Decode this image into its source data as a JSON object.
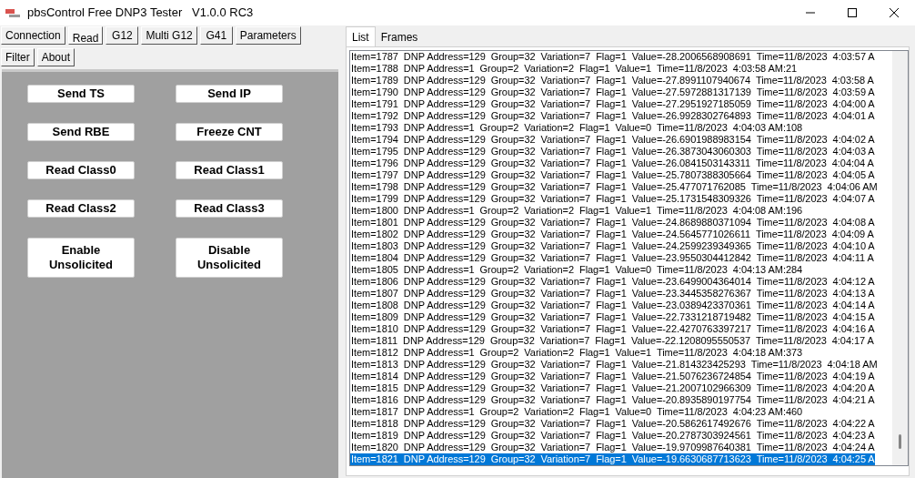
{
  "window": {
    "title": "pbsControl Free DNP3 Tester   V1.0.0 RC3"
  },
  "tab_rows": [
    [
      {
        "label": "Connection",
        "selected": false
      },
      {
        "label": "Read",
        "selected": true
      },
      {
        "label": "G12",
        "selected": false
      },
      {
        "label": "Multi G12",
        "selected": false
      },
      {
        "label": "G41",
        "selected": false
      },
      {
        "label": "Parameters",
        "selected": false
      }
    ],
    [
      {
        "label": "Filter",
        "selected": false
      },
      {
        "label": "About",
        "selected": false
      }
    ]
  ],
  "buttons": [
    {
      "label": "Send TS"
    },
    {
      "label": "Send IP"
    },
    {
      "label": "Send RBE"
    },
    {
      "label": "Freeze CNT"
    },
    {
      "label": "Read Class0"
    },
    {
      "label": "Read  Class1"
    },
    {
      "label": "Read  Class2"
    },
    {
      "label": "Read  Class3"
    },
    {
      "label": "Enable Unsolicited"
    },
    {
      "label": "Disable Unsolicited"
    }
  ],
  "list_tabs": [
    {
      "label": "List",
      "selected": true
    },
    {
      "label": "Frames",
      "selected": false
    }
  ],
  "list": {
    "rows": [
      {
        "text": "Item=1787  DNP Address=129  Group=32  Variation=7  Flag=1  Value=-28.2006568908691  Time=11/8/2023  4:03:57 A",
        "selected": false
      },
      {
        "text": "Item=1788  DNP Address=1  Group=2  Variation=2  Flag=1  Value=1  Time=11/8/2023  4:03:58 AM:21",
        "selected": false
      },
      {
        "text": "Item=1789  DNP Address=129  Group=32  Variation=7  Flag=1  Value=-27.8991107940674  Time=11/8/2023  4:03:58 A",
        "selected": false
      },
      {
        "text": "Item=1790  DNP Address=129  Group=32  Variation=7  Flag=1  Value=-27.5972881317139  Time=11/8/2023  4:03:59 A",
        "selected": false
      },
      {
        "text": "Item=1791  DNP Address=129  Group=32  Variation=7  Flag=1  Value=-27.2951927185059  Time=11/8/2023  4:04:00 A",
        "selected": false
      },
      {
        "text": "Item=1792  DNP Address=129  Group=32  Variation=7  Flag=1  Value=-26.9928302764893  Time=11/8/2023  4:04:01 A",
        "selected": false
      },
      {
        "text": "Item=1793  DNP Address=1  Group=2  Variation=2  Flag=1  Value=0  Time=11/8/2023  4:04:03 AM:108",
        "selected": false
      },
      {
        "text": "Item=1794  DNP Address=129  Group=32  Variation=7  Flag=1  Value=-26.6901988983154  Time=11/8/2023  4:04:02 A",
        "selected": false
      },
      {
        "text": "Item=1795  DNP Address=129  Group=32  Variation=7  Flag=1  Value=-26.3873043060303  Time=11/8/2023  4:04:03 A",
        "selected": false
      },
      {
        "text": "Item=1796  DNP Address=129  Group=32  Variation=7  Flag=1  Value=-26.0841503143311  Time=11/8/2023  4:04:04 A",
        "selected": false
      },
      {
        "text": "Item=1797  DNP Address=129  Group=32  Variation=7  Flag=1  Value=-25.7807388305664  Time=11/8/2023  4:04:05 A",
        "selected": false
      },
      {
        "text": "Item=1798  DNP Address=129  Group=32  Variation=7  Flag=1  Value=-25.477071762085  Time=11/8/2023  4:04:06 AM",
        "selected": false
      },
      {
        "text": "Item=1799  DNP Address=129  Group=32  Variation=7  Flag=1  Value=-25.1731548309326  Time=11/8/2023  4:04:07 A",
        "selected": false
      },
      {
        "text": "Item=1800  DNP Address=1  Group=2  Variation=2  Flag=1  Value=1  Time=11/8/2023  4:04:08 AM:196",
        "selected": false
      },
      {
        "text": "Item=1801  DNP Address=129  Group=32  Variation=7  Flag=1  Value=-24.8689880371094  Time=11/8/2023  4:04:08 A",
        "selected": false
      },
      {
        "text": "Item=1802  DNP Address=129  Group=32  Variation=7  Flag=1  Value=-24.5645771026611  Time=11/8/2023  4:04:09 A",
        "selected": false
      },
      {
        "text": "Item=1803  DNP Address=129  Group=32  Variation=7  Flag=1  Value=-24.2599239349365  Time=11/8/2023  4:04:10 A",
        "selected": false
      },
      {
        "text": "Item=1804  DNP Address=129  Group=32  Variation=7  Flag=1  Value=-23.9550304412842  Time=11/8/2023  4:04:11 A",
        "selected": false
      },
      {
        "text": "Item=1805  DNP Address=1  Group=2  Variation=2  Flag=1  Value=0  Time=11/8/2023  4:04:13 AM:284",
        "selected": false
      },
      {
        "text": "Item=1806  DNP Address=129  Group=32  Variation=7  Flag=1  Value=-23.6499004364014  Time=11/8/2023  4:04:12 A",
        "selected": false
      },
      {
        "text": "Item=1807  DNP Address=129  Group=32  Variation=7  Flag=1  Value=-23.3445358276367  Time=11/8/2023  4:04:13 A",
        "selected": false
      },
      {
        "text": "Item=1808  DNP Address=129  Group=32  Variation=7  Flag=1  Value=-23.0389423370361  Time=11/8/2023  4:04:14 A",
        "selected": false
      },
      {
        "text": "Item=1809  DNP Address=129  Group=32  Variation=7  Flag=1  Value=-22.7331218719482  Time=11/8/2023  4:04:15 A",
        "selected": false
      },
      {
        "text": "Item=1810  DNP Address=129  Group=32  Variation=7  Flag=1  Value=-22.4270763397217  Time=11/8/2023  4:04:16 A",
        "selected": false
      },
      {
        "text": "Item=1811  DNP Address=129  Group=32  Variation=7  Flag=1  Value=-22.1208095550537  Time=11/8/2023  4:04:17 A",
        "selected": false
      },
      {
        "text": "Item=1812  DNP Address=1  Group=2  Variation=2  Flag=1  Value=1  Time=11/8/2023  4:04:18 AM:373",
        "selected": false
      },
      {
        "text": "Item=1813  DNP Address=129  Group=32  Variation=7  Flag=1  Value=-21.814323425293  Time=11/8/2023  4:04:18 AM",
        "selected": false
      },
      {
        "text": "Item=1814  DNP Address=129  Group=32  Variation=7  Flag=1  Value=-21.5076236724854  Time=11/8/2023  4:04:19 A",
        "selected": false
      },
      {
        "text": "Item=1815  DNP Address=129  Group=32  Variation=7  Flag=1  Value=-21.2007102966309  Time=11/8/2023  4:04:20 A",
        "selected": false
      },
      {
        "text": "Item=1816  DNP Address=129  Group=32  Variation=7  Flag=1  Value=-20.8935890197754  Time=11/8/2023  4:04:21 A",
        "selected": false
      },
      {
        "text": "Item=1817  DNP Address=1  Group=2  Variation=2  Flag=1  Value=0  Time=11/8/2023  4:04:23 AM:460",
        "selected": false
      },
      {
        "text": "Item=1818  DNP Address=129  Group=32  Variation=7  Flag=1  Value=-20.5862617492676  Time=11/8/2023  4:04:22 A",
        "selected": false
      },
      {
        "text": "Item=1819  DNP Address=129  Group=32  Variation=7  Flag=1  Value=-20.2787303924561  Time=11/8/2023  4:04:23 A",
        "selected": false
      },
      {
        "text": "Item=1820  DNP Address=129  Group=32  Variation=7  Flag=1  Value=-19.9709987640381  Time=11/8/2023  4:04:24 A",
        "selected": false
      },
      {
        "text": "Item=1821  DNP Address=129  Group=32  Variation=7  Flag=1  Value=-19.6630687713623  Time=11/8/2023  4:04:25 A",
        "selected": true
      }
    ]
  }
}
